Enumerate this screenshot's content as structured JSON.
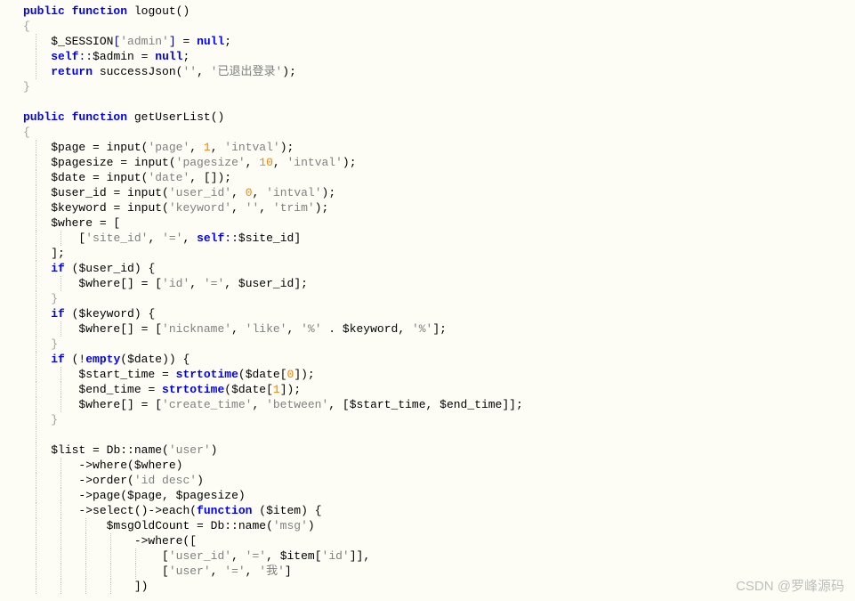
{
  "watermark": "CSDN @罗峰源码",
  "lines": [
    {
      "i": 0,
      "g": [],
      "s": [
        {
          "t": "public",
          "c": "kw"
        },
        {
          "t": " ",
          "c": ""
        },
        {
          "t": "function",
          "c": "kw"
        },
        {
          "t": " ",
          "c": ""
        },
        {
          "t": "logout",
          "c": "fn"
        },
        {
          "t": "()",
          "c": "punc"
        }
      ]
    },
    {
      "i": 0,
      "g": [],
      "s": [
        {
          "t": "{",
          "c": "brace"
        }
      ]
    },
    {
      "i": 1,
      "g": [
        1
      ],
      "s": [
        {
          "t": "$_SESSION",
          "c": "var"
        },
        {
          "t": "[",
          "c": "op"
        },
        {
          "t": "'admin'",
          "c": "str"
        },
        {
          "t": "]",
          "c": "op"
        },
        {
          "t": " = ",
          "c": ""
        },
        {
          "t": "null",
          "c": "kw"
        },
        {
          "t": ";",
          "c": ""
        }
      ]
    },
    {
      "i": 1,
      "g": [
        1
      ],
      "s": [
        {
          "t": "self",
          "c": "kw"
        },
        {
          "t": "::",
          "c": "op"
        },
        {
          "t": "$admin",
          "c": "var"
        },
        {
          "t": " = ",
          "c": ""
        },
        {
          "t": "null",
          "c": "kw"
        },
        {
          "t": ";",
          "c": ""
        }
      ]
    },
    {
      "i": 1,
      "g": [
        1
      ],
      "s": [
        {
          "t": "return",
          "c": "kw"
        },
        {
          "t": " successJson(",
          "c": ""
        },
        {
          "t": "''",
          "c": "str"
        },
        {
          "t": ", ",
          "c": ""
        },
        {
          "t": "'已退出登录'",
          "c": "str"
        },
        {
          "t": ");",
          "c": ""
        }
      ]
    },
    {
      "i": 0,
      "g": [],
      "s": [
        {
          "t": "}",
          "c": "brace"
        }
      ]
    },
    {
      "i": 0,
      "g": [],
      "s": [
        {
          "t": " ",
          "c": ""
        }
      ]
    },
    {
      "i": 0,
      "g": [],
      "s": [
        {
          "t": "public",
          "c": "kw"
        },
        {
          "t": " ",
          "c": ""
        },
        {
          "t": "function",
          "c": "kw"
        },
        {
          "t": " ",
          "c": ""
        },
        {
          "t": "getUserList",
          "c": "fn"
        },
        {
          "t": "()",
          "c": "punc"
        }
      ]
    },
    {
      "i": 0,
      "g": [],
      "s": [
        {
          "t": "{",
          "c": "brace"
        }
      ]
    },
    {
      "i": 1,
      "g": [
        1
      ],
      "s": [
        {
          "t": "$page",
          "c": "var"
        },
        {
          "t": " = input(",
          "c": ""
        },
        {
          "t": "'page'",
          "c": "str"
        },
        {
          "t": ", ",
          "c": ""
        },
        {
          "t": "1",
          "c": "num"
        },
        {
          "t": ", ",
          "c": ""
        },
        {
          "t": "'intval'",
          "c": "str"
        },
        {
          "t": ");",
          "c": ""
        }
      ]
    },
    {
      "i": 1,
      "g": [
        1
      ],
      "s": [
        {
          "t": "$pagesize",
          "c": "var"
        },
        {
          "t": " = input(",
          "c": ""
        },
        {
          "t": "'pagesize'",
          "c": "str"
        },
        {
          "t": ", ",
          "c": ""
        },
        {
          "t": "10",
          "c": "num"
        },
        {
          "t": ", ",
          "c": ""
        },
        {
          "t": "'intval'",
          "c": "str"
        },
        {
          "t": ");",
          "c": ""
        }
      ]
    },
    {
      "i": 1,
      "g": [
        1
      ],
      "s": [
        {
          "t": "$date",
          "c": "var"
        },
        {
          "t": " = input(",
          "c": ""
        },
        {
          "t": "'date'",
          "c": "str"
        },
        {
          "t": ", []);",
          "c": ""
        }
      ]
    },
    {
      "i": 1,
      "g": [
        1
      ],
      "s": [
        {
          "t": "$user_id",
          "c": "var"
        },
        {
          "t": " = input(",
          "c": ""
        },
        {
          "t": "'user_id'",
          "c": "str"
        },
        {
          "t": ", ",
          "c": ""
        },
        {
          "t": "0",
          "c": "num"
        },
        {
          "t": ", ",
          "c": ""
        },
        {
          "t": "'intval'",
          "c": "str"
        },
        {
          "t": ");",
          "c": ""
        }
      ]
    },
    {
      "i": 1,
      "g": [
        1
      ],
      "s": [
        {
          "t": "$keyword",
          "c": "var"
        },
        {
          "t": " = input(",
          "c": ""
        },
        {
          "t": "'keyword'",
          "c": "str"
        },
        {
          "t": ", ",
          "c": ""
        },
        {
          "t": "''",
          "c": "str"
        },
        {
          "t": ", ",
          "c": ""
        },
        {
          "t": "'trim'",
          "c": "str"
        },
        {
          "t": ");",
          "c": ""
        }
      ]
    },
    {
      "i": 1,
      "g": [
        1
      ],
      "s": [
        {
          "t": "$where",
          "c": "var"
        },
        {
          "t": " = [",
          "c": ""
        }
      ]
    },
    {
      "i": 2,
      "g": [
        1,
        2
      ],
      "s": [
        {
          "t": "[",
          "c": ""
        },
        {
          "t": "'site_id'",
          "c": "str"
        },
        {
          "t": ", ",
          "c": ""
        },
        {
          "t": "'='",
          "c": "str"
        },
        {
          "t": ", ",
          "c": ""
        },
        {
          "t": "self",
          "c": "kw"
        },
        {
          "t": "::",
          "c": "op"
        },
        {
          "t": "$site_id",
          "c": "var"
        },
        {
          "t": "]",
          "c": ""
        }
      ]
    },
    {
      "i": 1,
      "g": [
        1
      ],
      "s": [
        {
          "t": "];",
          "c": ""
        }
      ]
    },
    {
      "i": 1,
      "g": [
        1
      ],
      "s": [
        {
          "t": "if",
          "c": "kw"
        },
        {
          "t": " (",
          "c": ""
        },
        {
          "t": "$user_id",
          "c": "var"
        },
        {
          "t": ") {",
          "c": ""
        }
      ]
    },
    {
      "i": 2,
      "g": [
        1,
        2
      ],
      "s": [
        {
          "t": "$where",
          "c": "var"
        },
        {
          "t": "[] = [",
          "c": ""
        },
        {
          "t": "'id'",
          "c": "str"
        },
        {
          "t": ", ",
          "c": ""
        },
        {
          "t": "'='",
          "c": "str"
        },
        {
          "t": ", ",
          "c": ""
        },
        {
          "t": "$user_id",
          "c": "var"
        },
        {
          "t": "];",
          "c": ""
        }
      ]
    },
    {
      "i": 1,
      "g": [
        1
      ],
      "s": [
        {
          "t": "}",
          "c": "brace"
        }
      ]
    },
    {
      "i": 1,
      "g": [
        1
      ],
      "s": [
        {
          "t": "if",
          "c": "kw"
        },
        {
          "t": " (",
          "c": ""
        },
        {
          "t": "$keyword",
          "c": "var"
        },
        {
          "t": ") {",
          "c": ""
        }
      ]
    },
    {
      "i": 2,
      "g": [
        1,
        2
      ],
      "s": [
        {
          "t": "$where",
          "c": "var"
        },
        {
          "t": "[] = [",
          "c": ""
        },
        {
          "t": "'nickname'",
          "c": "str"
        },
        {
          "t": ", ",
          "c": ""
        },
        {
          "t": "'like'",
          "c": "str"
        },
        {
          "t": ", ",
          "c": ""
        },
        {
          "t": "'%'",
          "c": "str"
        },
        {
          "t": " . ",
          "c": ""
        },
        {
          "t": "$keyword",
          "c": "var"
        },
        {
          "t": ", ",
          "c": ""
        },
        {
          "t": "'%'",
          "c": "str"
        },
        {
          "t": "];",
          "c": ""
        }
      ]
    },
    {
      "i": 1,
      "g": [
        1
      ],
      "s": [
        {
          "t": "}",
          "c": "brace"
        }
      ]
    },
    {
      "i": 1,
      "g": [
        1
      ],
      "s": [
        {
          "t": "if",
          "c": "kw"
        },
        {
          "t": " (!",
          "c": ""
        },
        {
          "t": "empty",
          "c": "kw"
        },
        {
          "t": "(",
          "c": ""
        },
        {
          "t": "$date",
          "c": "var"
        },
        {
          "t": ")) {",
          "c": ""
        }
      ]
    },
    {
      "i": 2,
      "g": [
        1,
        2
      ],
      "s": [
        {
          "t": "$start_time",
          "c": "var"
        },
        {
          "t": " = ",
          "c": ""
        },
        {
          "t": "strtotime",
          "c": "kw"
        },
        {
          "t": "(",
          "c": ""
        },
        {
          "t": "$date",
          "c": "var"
        },
        {
          "t": "[",
          "c": ""
        },
        {
          "t": "0",
          "c": "num"
        },
        {
          "t": "]);",
          "c": ""
        }
      ]
    },
    {
      "i": 2,
      "g": [
        1,
        2
      ],
      "s": [
        {
          "t": "$end_time",
          "c": "var"
        },
        {
          "t": " = ",
          "c": ""
        },
        {
          "t": "strtotime",
          "c": "kw"
        },
        {
          "t": "(",
          "c": ""
        },
        {
          "t": "$date",
          "c": "var"
        },
        {
          "t": "[",
          "c": ""
        },
        {
          "t": "1",
          "c": "num"
        },
        {
          "t": "]);",
          "c": ""
        }
      ]
    },
    {
      "i": 2,
      "g": [
        1,
        2
      ],
      "s": [
        {
          "t": "$where",
          "c": "var"
        },
        {
          "t": "[] = [",
          "c": ""
        },
        {
          "t": "'create_time'",
          "c": "str"
        },
        {
          "t": ", ",
          "c": ""
        },
        {
          "t": "'between'",
          "c": "str"
        },
        {
          "t": ", [",
          "c": ""
        },
        {
          "t": "$start_time",
          "c": "var"
        },
        {
          "t": ", ",
          "c": ""
        },
        {
          "t": "$end_time",
          "c": "var"
        },
        {
          "t": "]];",
          "c": ""
        }
      ]
    },
    {
      "i": 1,
      "g": [
        1
      ],
      "s": [
        {
          "t": "}",
          "c": "brace"
        }
      ]
    },
    {
      "i": 1,
      "g": [
        1
      ],
      "s": [
        {
          "t": " ",
          "c": ""
        }
      ]
    },
    {
      "i": 1,
      "g": [
        1
      ],
      "s": [
        {
          "t": "$list",
          "c": "var"
        },
        {
          "t": " = Db::name(",
          "c": ""
        },
        {
          "t": "'user'",
          "c": "str"
        },
        {
          "t": ")",
          "c": ""
        }
      ]
    },
    {
      "i": 2,
      "g": [
        1,
        2
      ],
      "s": [
        {
          "t": "->where(",
          "c": ""
        },
        {
          "t": "$where",
          "c": "var"
        },
        {
          "t": ")",
          "c": ""
        }
      ]
    },
    {
      "i": 2,
      "g": [
        1,
        2
      ],
      "s": [
        {
          "t": "->order(",
          "c": ""
        },
        {
          "t": "'id desc'",
          "c": "str"
        },
        {
          "t": ")",
          "c": ""
        }
      ]
    },
    {
      "i": 2,
      "g": [
        1,
        2
      ],
      "s": [
        {
          "t": "->page(",
          "c": ""
        },
        {
          "t": "$page",
          "c": "var"
        },
        {
          "t": ", ",
          "c": ""
        },
        {
          "t": "$pagesize",
          "c": "var"
        },
        {
          "t": ")",
          "c": ""
        }
      ]
    },
    {
      "i": 2,
      "g": [
        1,
        2
      ],
      "s": [
        {
          "t": "->select()->each(",
          "c": ""
        },
        {
          "t": "function",
          "c": "kw"
        },
        {
          "t": " (",
          "c": ""
        },
        {
          "t": "$item",
          "c": "var"
        },
        {
          "t": ") {",
          "c": ""
        }
      ]
    },
    {
      "i": 3,
      "g": [
        1,
        2,
        3
      ],
      "s": [
        {
          "t": "$msgOldCount",
          "c": "var"
        },
        {
          "t": " = Db::name(",
          "c": ""
        },
        {
          "t": "'msg'",
          "c": "str"
        },
        {
          "t": ")",
          "c": ""
        }
      ]
    },
    {
      "i": 4,
      "g": [
        1,
        2,
        3,
        4
      ],
      "s": [
        {
          "t": "->where([",
          "c": ""
        }
      ]
    },
    {
      "i": 5,
      "g": [
        1,
        2,
        3,
        4,
        5
      ],
      "s": [
        {
          "t": "[",
          "c": ""
        },
        {
          "t": "'user_id'",
          "c": "str"
        },
        {
          "t": ", ",
          "c": ""
        },
        {
          "t": "'='",
          "c": "str"
        },
        {
          "t": ", ",
          "c": ""
        },
        {
          "t": "$item",
          "c": "var"
        },
        {
          "t": "[",
          "c": ""
        },
        {
          "t": "'id'",
          "c": "str"
        },
        {
          "t": "]],",
          "c": ""
        }
      ]
    },
    {
      "i": 5,
      "g": [
        1,
        2,
        3,
        4,
        5
      ],
      "s": [
        {
          "t": "[",
          "c": ""
        },
        {
          "t": "'user'",
          "c": "str"
        },
        {
          "t": ", ",
          "c": ""
        },
        {
          "t": "'='",
          "c": "str"
        },
        {
          "t": ", ",
          "c": ""
        },
        {
          "t": "'我'",
          "c": "str"
        },
        {
          "t": "]",
          "c": ""
        }
      ]
    },
    {
      "i": 4,
      "g": [
        1,
        2,
        3,
        4
      ],
      "s": [
        {
          "t": "])",
          "c": ""
        }
      ]
    }
  ]
}
